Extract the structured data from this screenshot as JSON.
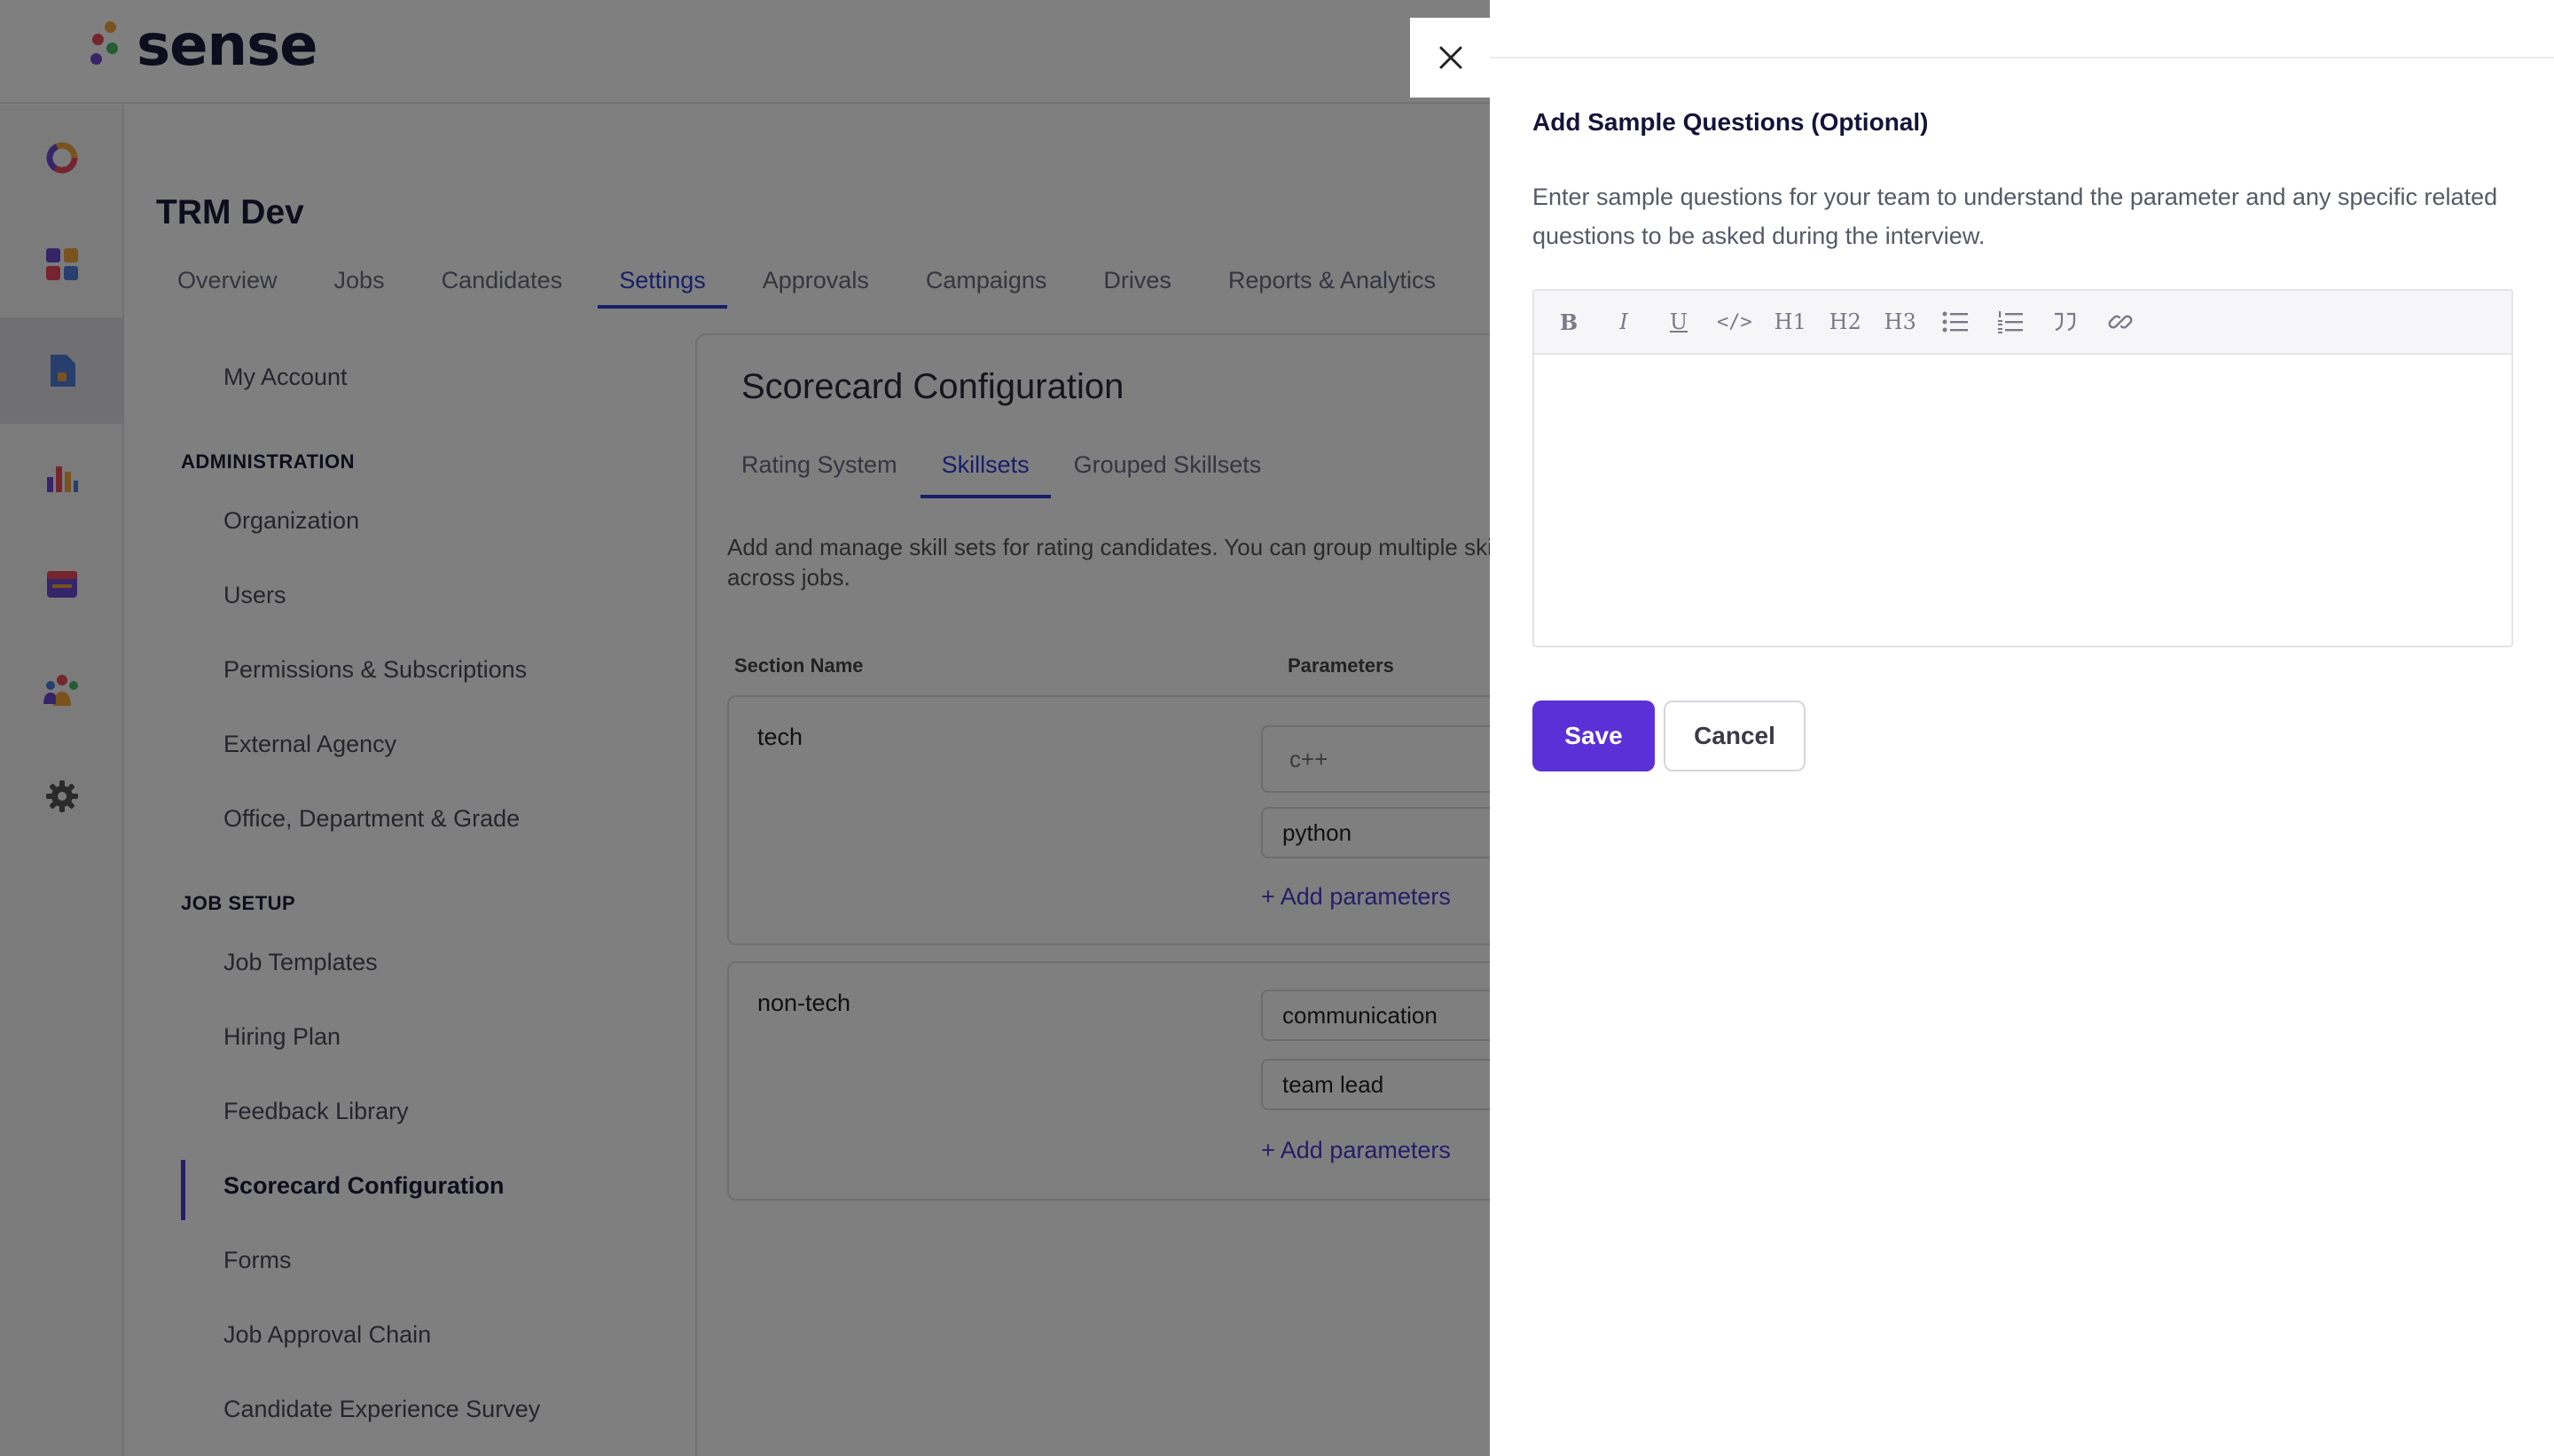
{
  "app": {
    "brand": "sense",
    "company": "TRM Dev",
    "nav_tabs": [
      {
        "label": "Overview"
      },
      {
        "label": "Jobs"
      },
      {
        "label": "Candidates"
      },
      {
        "label": "Settings"
      },
      {
        "label": "Approvals"
      },
      {
        "label": "Campaigns"
      },
      {
        "label": "Drives"
      },
      {
        "label": "Reports & Analytics"
      }
    ],
    "rail_icons": [
      "ring-icon",
      "dashboard-icon",
      "document-icon",
      "bar-chart-icon",
      "calendar-icon",
      "team-icon",
      "gear-icon"
    ]
  },
  "settings_menu": {
    "my_account": "My Account",
    "admin_heading": "ADMINISTRATION",
    "admin_items": [
      "Organization",
      "Users",
      "Permissions & Subscriptions",
      "External Agency",
      "Office, Department & Grade"
    ],
    "job_setup_heading": "JOB SETUP",
    "job_items": [
      "Job Templates",
      "Hiring Plan",
      "Feedback Library",
      "Scorecard Configuration",
      "Forms",
      "Job Approval Chain",
      "Candidate Experience Survey"
    ]
  },
  "scorecard": {
    "title": "Scorecard Configuration",
    "tabs": [
      "Rating System",
      "Skillsets",
      "Grouped Skillsets"
    ],
    "description": "Add and manage skill sets for rating candidates. You can group multiple skill sets and use them across jobs.",
    "col_section": "Section Name",
    "col_params": "Parameters",
    "sections": [
      {
        "name": "tech",
        "params": [
          "c++",
          "python"
        ],
        "add": "+ Add parameters"
      },
      {
        "name": "non-tech",
        "params": [
          "communication",
          "team lead"
        ],
        "add": "+ Add parameters"
      }
    ]
  },
  "drawer": {
    "title": "Add Sample Questions (Optional)",
    "description": "Enter sample questions for your team to understand the parameter and any specific related questions to be asked during the interview.",
    "toolbar": {
      "bold": "B",
      "italic": "I",
      "underline": "U",
      "code": "</>",
      "h1": "H1",
      "h2": "H2",
      "h3": "H3"
    },
    "save_label": "Save",
    "cancel_label": "Cancel"
  }
}
